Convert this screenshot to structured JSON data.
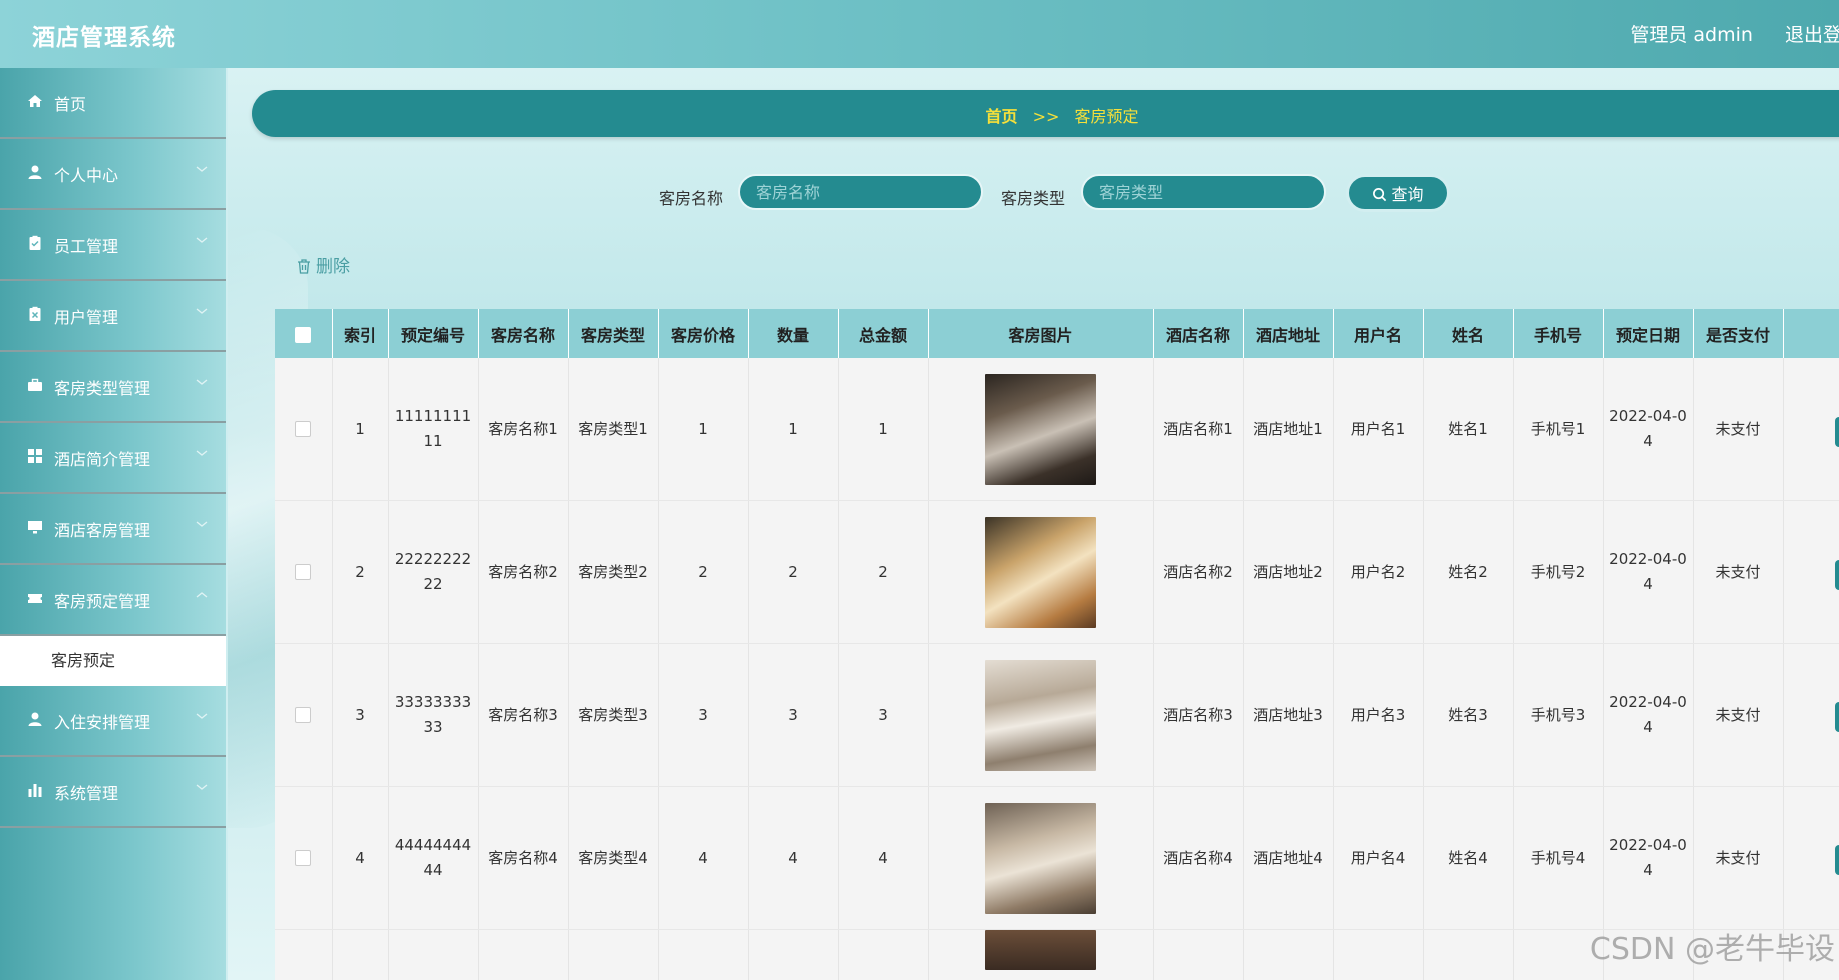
{
  "app": {
    "title": "酒店管理系统",
    "admin_label": "管理员 admin",
    "logout_label": "退出登录"
  },
  "sidebar": {
    "items": [
      {
        "label": "首页",
        "icon": "home-icon",
        "has_arrow": false
      },
      {
        "label": "个人中心",
        "icon": "user-icon",
        "has_arrow": true
      },
      {
        "label": "员工管理",
        "icon": "clipboard-icon",
        "has_arrow": true
      },
      {
        "label": "用户管理",
        "icon": "clipboard-x-icon",
        "has_arrow": true
      },
      {
        "label": "客房类型管理",
        "icon": "briefcase-icon",
        "has_arrow": true
      },
      {
        "label": "酒店简介管理",
        "icon": "grid-icon",
        "has_arrow": true
      },
      {
        "label": "酒店客房管理",
        "icon": "monitor-icon",
        "has_arrow": true
      },
      {
        "label": "客房预定管理",
        "icon": "ticket-icon",
        "has_arrow": true
      },
      {
        "label": "入住安排管理",
        "icon": "user-icon",
        "has_arrow": true
      },
      {
        "label": "系统管理",
        "icon": "bar-chart-icon",
        "has_arrow": true
      }
    ],
    "active_sub": "客房预定"
  },
  "breadcrumb": {
    "home": "首页",
    "separator": ">>",
    "current": "客房预定"
  },
  "search": {
    "room_name_label": "客房名称",
    "room_name_placeholder": "客房名称",
    "room_type_label": "客房类型",
    "room_type_placeholder": "客房类型",
    "query_label": "查询"
  },
  "actions": {
    "delete_label": "删除"
  },
  "table": {
    "columns": [
      "索引",
      "预定编号",
      "客房名称",
      "客房类型",
      "客房价格",
      "数量",
      "总金额",
      "客房图片",
      "酒店名称",
      "酒店地址",
      "用户名",
      "姓名",
      "手机号",
      "预定日期",
      "是否支付"
    ],
    "rows": [
      {
        "index": "1",
        "order_no": "1111111111",
        "room_name": "客房名称1",
        "room_type": "客房类型1",
        "price": "1",
        "qty": "1",
        "total": "1",
        "hotel_name": "酒店名称1",
        "hotel_addr": "酒店地址1",
        "username": "用户名1",
        "name": "姓名1",
        "phone": "手机号1",
        "date": "2022-04-04",
        "paid": "未支付"
      },
      {
        "index": "2",
        "order_no": "2222222222",
        "room_name": "客房名称2",
        "room_type": "客房类型2",
        "price": "2",
        "qty": "2",
        "total": "2",
        "hotel_name": "酒店名称2",
        "hotel_addr": "酒店地址2",
        "username": "用户名2",
        "name": "姓名2",
        "phone": "手机号2",
        "date": "2022-04-04",
        "paid": "未支付"
      },
      {
        "index": "3",
        "order_no": "3333333333",
        "room_name": "客房名称3",
        "room_type": "客房类型3",
        "price": "3",
        "qty": "3",
        "total": "3",
        "hotel_name": "酒店名称3",
        "hotel_addr": "酒店地址3",
        "username": "用户名3",
        "name": "姓名3",
        "phone": "手机号3",
        "date": "2022-04-04",
        "paid": "未支付"
      },
      {
        "index": "4",
        "order_no": "4444444444",
        "room_name": "客房名称4",
        "room_type": "客房类型4",
        "price": "4",
        "qty": "4",
        "total": "4",
        "hotel_name": "酒店名称4",
        "hotel_addr": "酒店地址4",
        "username": "用户名4",
        "name": "姓名4",
        "phone": "手机号4",
        "date": "2022-04-04",
        "paid": "未支付"
      }
    ]
  },
  "watermark": "CSDN @老牛毕设",
  "colors": {
    "primary": "#248b90",
    "header_row": "#8ccfd4",
    "breadcrumb_text": "#f6e03a"
  }
}
